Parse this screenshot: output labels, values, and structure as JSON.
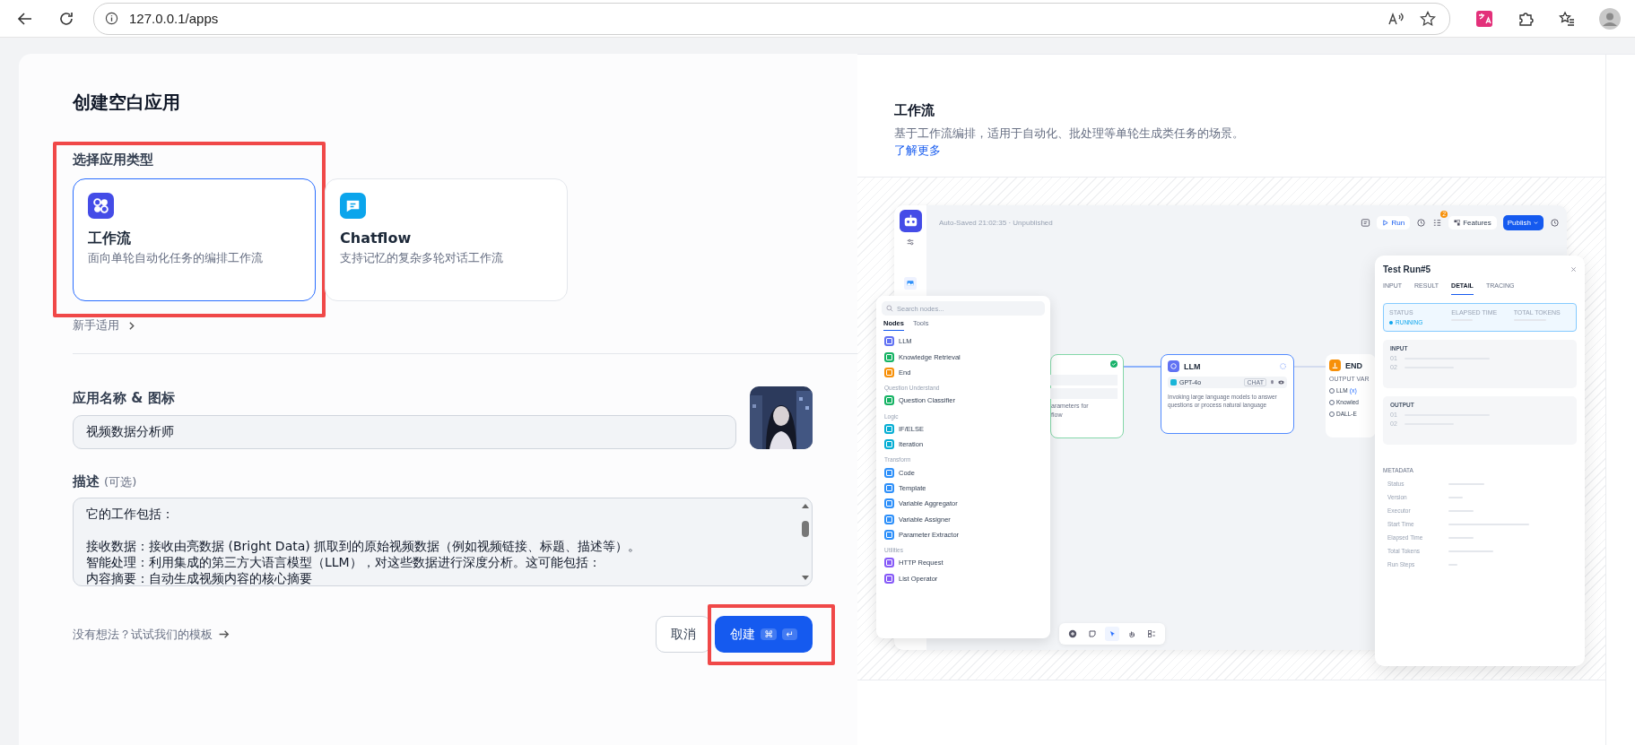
{
  "browser": {
    "url": "127.0.0.1/apps"
  },
  "dialog": {
    "title": "创建空白应用",
    "type_section": {
      "label": "选择应用类型",
      "types": [
        {
          "kind": "workflow",
          "name": "工作流",
          "description": "面向单轮自动化任务的编排工作流",
          "selected": true,
          "highlighted": true
        },
        {
          "kind": "chatflow",
          "name": "Chatflow",
          "description": "支持记忆的复杂多轮对话工作流",
          "selected": false,
          "highlighted": false
        }
      ],
      "beginner_link": "新手适用"
    },
    "name_section": {
      "label": "应用名称 & 图标",
      "value": "视频数据分析师"
    },
    "description_section": {
      "label": "描述",
      "hint": "(可选)",
      "lines": [
        "它的工作包括：",
        "接收数据：接收由亮数据 (Bright Data) 抓取到的原始视频数据（例如视频链接、标题、描述等）。",
        "智能处理：利用集成的第三方大语言模型（LLM），对这些数据进行深度分析。这可能包括：",
        "内容摘要：自动生成视频内容的核心摘要"
      ]
    },
    "template_link": "没有想法？试试我们的模板",
    "cancel_button": "取消",
    "create_button": {
      "label": "创建",
      "shortcut": [
        "⌘",
        "↵"
      ],
      "highlighted": true
    }
  },
  "preview": {
    "title": "工作流",
    "description": "基于工作流编排，适用于自动化、批处理等单轮生成类任务的场景。",
    "link": "了解更多",
    "screenshot": {
      "save_status": "Auto-Saved 21:02:35 · Unpublished",
      "toolbar": {
        "run": "Run",
        "badge": "2",
        "features": "Features",
        "publish": "Publish"
      },
      "node_panel": {
        "search_placeholder": "Search nodes...",
        "tabs": [
          {
            "label": "Nodes",
            "selected": true
          },
          {
            "label": "Tools",
            "selected": false
          }
        ],
        "groups": [
          {
            "items": [
              {
                "label": "LLM",
                "color": "#6172f3"
              },
              {
                "label": "Knowledge Retrieval",
                "color": "#16b364"
              },
              {
                "label": "End",
                "color": "#f79009"
              }
            ]
          },
          {
            "title": "Question Understand",
            "items": [
              {
                "label": "Question Classifier",
                "color": "#16b364"
              }
            ]
          },
          {
            "title": "Logic",
            "items": [
              {
                "label": "IF/ELSE",
                "color": "#06aed4"
              },
              {
                "label": "Iteration",
                "color": "#06aed4"
              }
            ]
          },
          {
            "title": "Transform",
            "items": [
              {
                "label": "Code",
                "color": "#2e90fa"
              },
              {
                "label": "Template",
                "color": "#2e90fa"
              },
              {
                "label": "Variable Aggregator",
                "color": "#2e90fa"
              },
              {
                "label": "Variable Assigner",
                "color": "#2e90fa"
              },
              {
                "label": "Parameter Extractor",
                "color": "#2e90fa"
              }
            ]
          },
          {
            "title": "Utilities",
            "items": [
              {
                "label": "HTTP Request",
                "color": "#875bf7"
              },
              {
                "label": "List Operator",
                "color": "#875bf7"
              }
            ]
          }
        ]
      },
      "nodes": [
        {
          "kind": "start",
          "lines": [
            "arameters for",
            "flow"
          ]
        },
        {
          "kind": "llm",
          "title": "LLM",
          "model": "GPT-4o",
          "mode": "CHAT",
          "description": "Invoking large language models to answer questions or process natural language"
        },
        {
          "kind": "end",
          "title": "END",
          "output_label": "OUTPUT VAR",
          "outputs": [
            {
              "label": "LLM",
              "tag": "(x)"
            },
            {
              "label": "Knowled"
            },
            {
              "label": "DALL-E"
            }
          ]
        }
      ],
      "test_run": {
        "title": "Test Run#5",
        "tabs": [
          {
            "label": "INPUT",
            "selected": false
          },
          {
            "label": "RESULT",
            "selected": false
          },
          {
            "label": "DETAIL",
            "selected": true
          },
          {
            "label": "TRACING",
            "selected": false
          }
        ],
        "status": {
          "labels": [
            "STATUS",
            "ELAPSED TIME",
            "TOTAL TOKENS"
          ],
          "value": "RUNNING"
        },
        "sections": [
          {
            "title": "INPUT",
            "rows": [
              "01",
              "02"
            ]
          },
          {
            "title": "OUTPUT",
            "rows": [
              "01",
              "02"
            ]
          }
        ],
        "metadata_title": "METADATA",
        "metadata": [
          "Status",
          "Version",
          "Executor",
          "Start Time",
          "Elapsed Time",
          "Total Tokens",
          "Run Steps"
        ]
      }
    }
  }
}
